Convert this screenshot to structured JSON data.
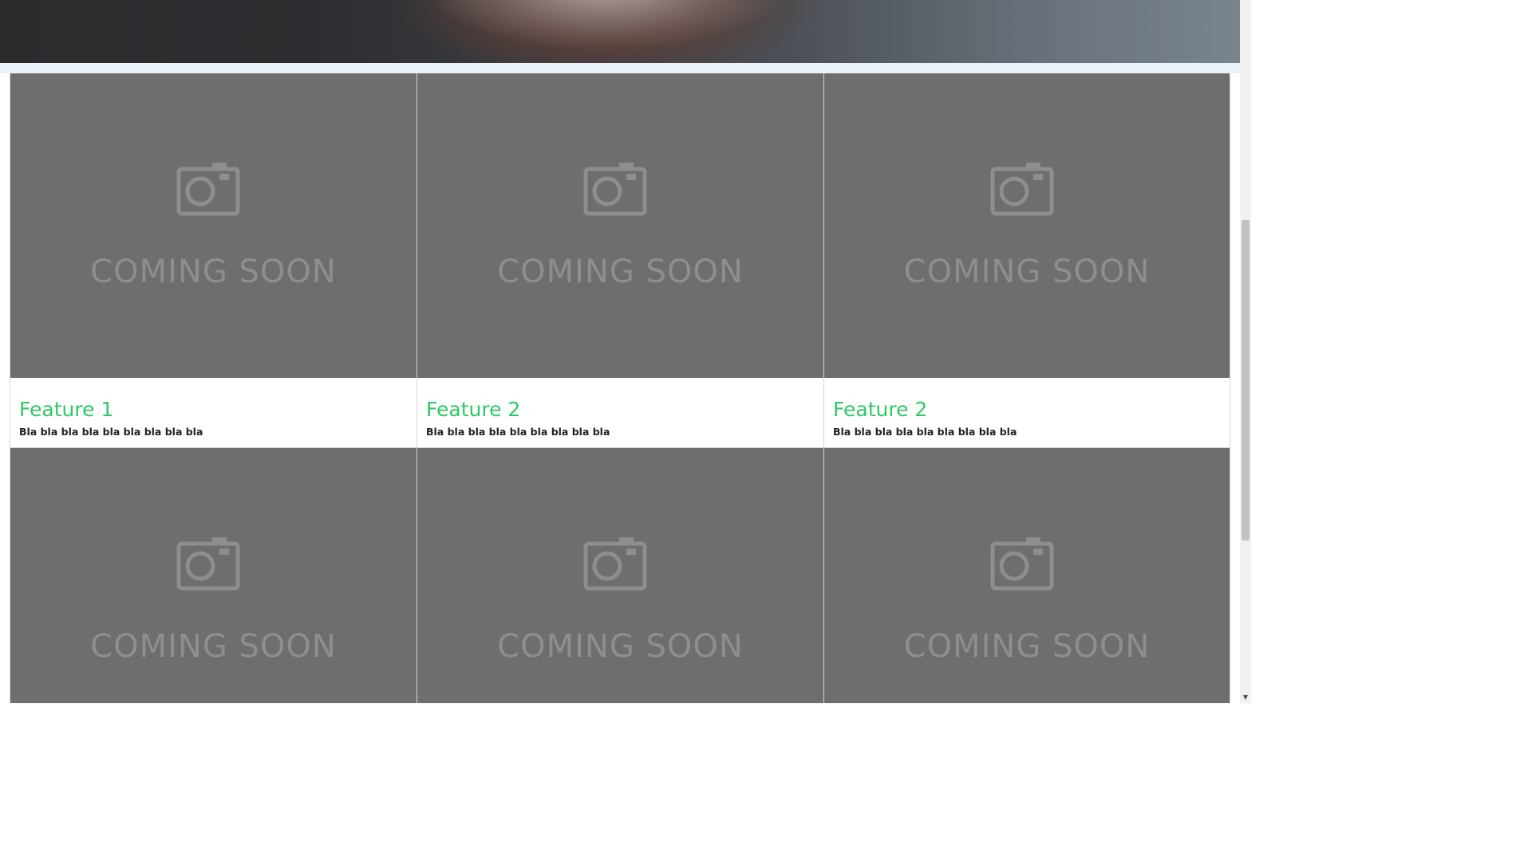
{
  "hero": {
    "image_label": "hero-photo-hands"
  },
  "placeholder": {
    "text": "COMING SOON",
    "icon": "camera-icon"
  },
  "features": [
    {
      "title": "Feature 1",
      "desc": "Bla bla bla bla bla bla bla bla bla"
    },
    {
      "title": "Feature 2",
      "desc": "Bla bla bla bla bla bla bla bla bla"
    },
    {
      "title": "Feature 2",
      "desc": "Bla bla bla bla bla bla bla bla bla"
    },
    {
      "title": "",
      "desc": ""
    },
    {
      "title": "",
      "desc": ""
    },
    {
      "title": "",
      "desc": ""
    }
  ],
  "scrollbar": {
    "down_arrow": "▼"
  },
  "colors": {
    "title_green": "#2ec866",
    "placeholder_bg": "#6e6e6e",
    "placeholder_fg": "#8e8e8e",
    "hero_band": "#eaf2fa"
  }
}
